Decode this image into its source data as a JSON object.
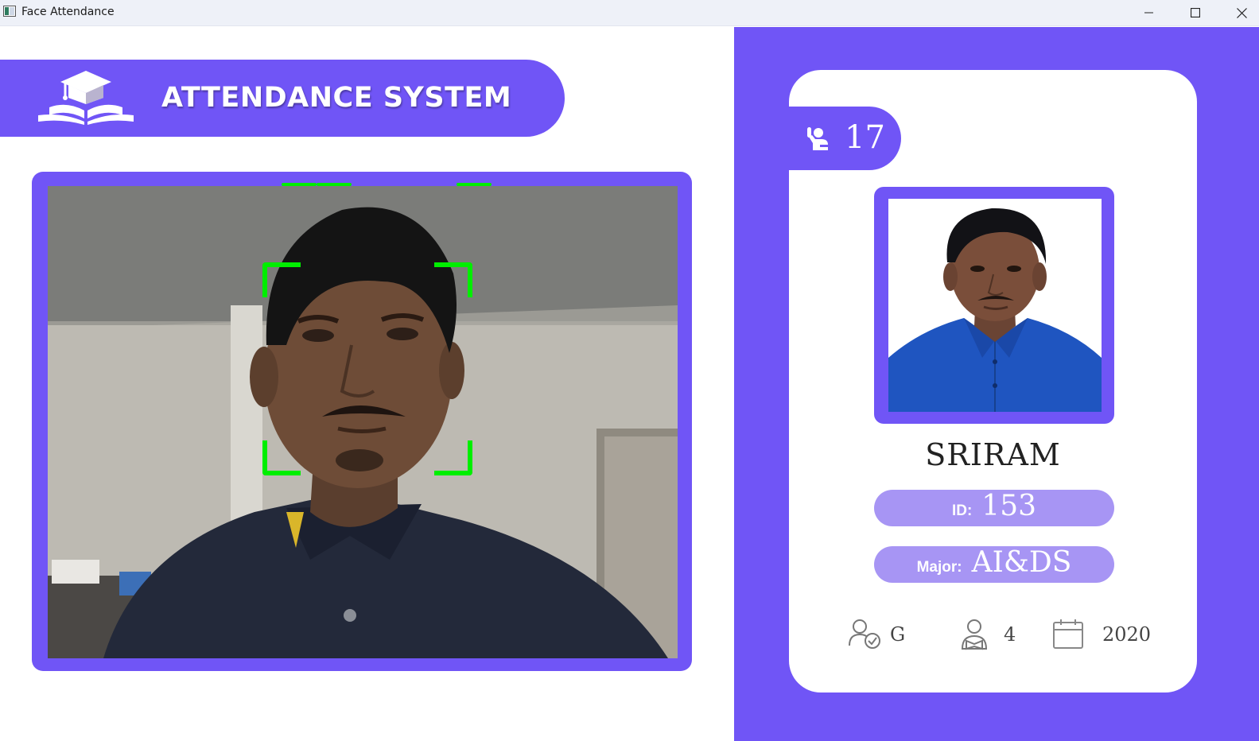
{
  "window": {
    "title": "Face Attendance",
    "controls": {
      "minimize": "minimize",
      "maximize": "maximize",
      "close": "close"
    }
  },
  "banner": {
    "title": "ATTENDANCE SYSTEM",
    "logo_icon": "graduation-cap-book-icon"
  },
  "camera": {
    "bracket_color": "#00ee00"
  },
  "student": {
    "attendance_count": "17",
    "name": "SRIRAM",
    "id_label": "ID:",
    "id_value": "153",
    "major_label": "Major:",
    "major_value": "AI&DS",
    "standing": "G",
    "year": "4",
    "starting_year": "2020"
  },
  "icons": {
    "attendance": "raised-hand-person-icon",
    "standing": "user-check-icon",
    "year": "user-reading-icon",
    "starting_year": "calendar-icon"
  },
  "colors": {
    "accent": "#7055f6",
    "pill": "#a795f4",
    "titlebar": "#eef1f8"
  }
}
